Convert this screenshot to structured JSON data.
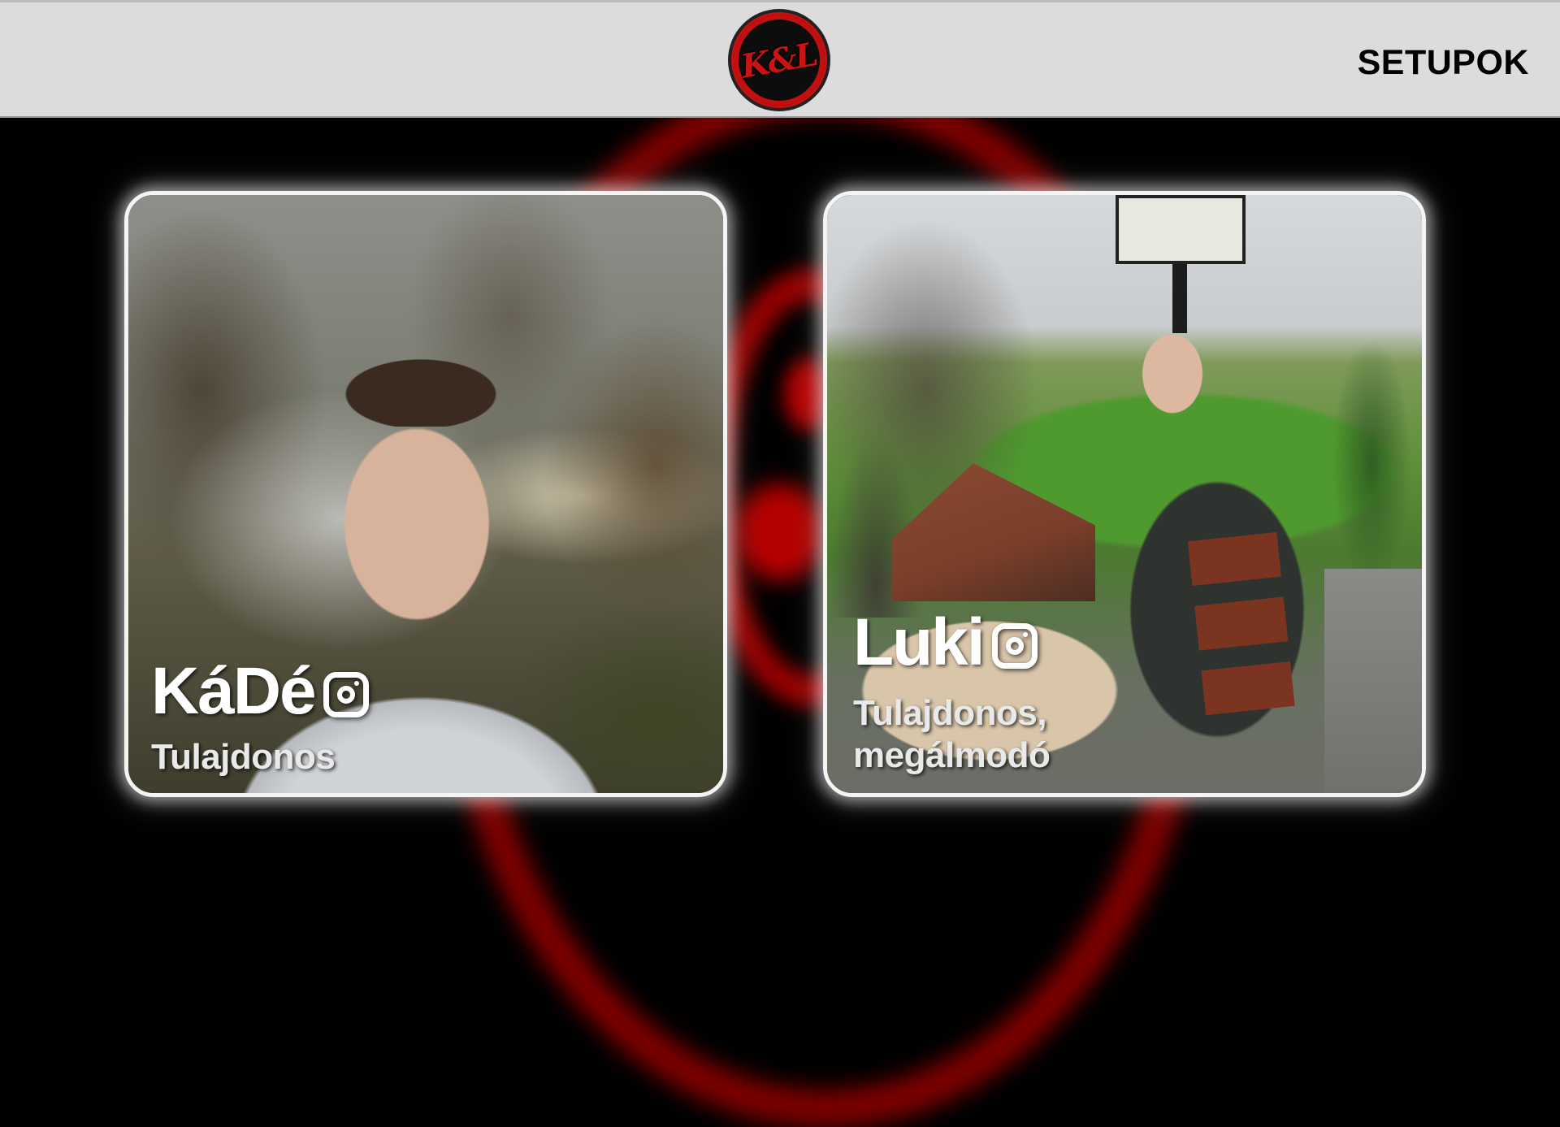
{
  "header": {
    "logo_text": "K&L",
    "nav_setups": "SETUPOK"
  },
  "colors": {
    "header_bg": "#dcdcdc",
    "page_bg": "#000000",
    "accent_red": "#c41212",
    "card_border": "#f4f4f4"
  },
  "cards": [
    {
      "name": "KáDé",
      "icon": "instagram-icon",
      "role": "Tulajdonos"
    },
    {
      "name": "Luki",
      "icon": "instagram-icon",
      "role": "Tulajdonos, megálmodó"
    }
  ]
}
